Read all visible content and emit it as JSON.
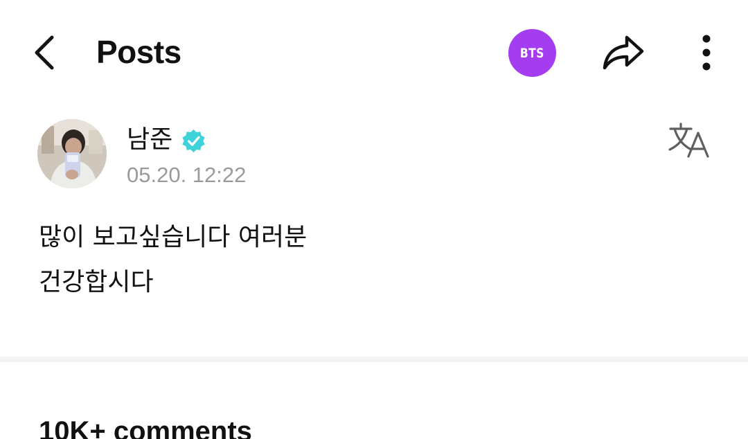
{
  "header": {
    "back_icon": "chevron-left-icon",
    "title": "Posts",
    "community_badge": "BTS",
    "community_badge_color": "#a43cf0",
    "share_icon": "share-arrow-icon",
    "more_icon": "vertical-dots-icon"
  },
  "post": {
    "author_name": "남준",
    "verified_icon": "verified-badge-icon",
    "verified_color": "#3ed3d8",
    "timestamp": "05.20. 12:22",
    "translate_icon": "translate-icon",
    "body_lines": [
      "많이 보고싶습니다 여러분",
      "건강합시다"
    ]
  },
  "comments": {
    "header": "10K+ comments"
  }
}
